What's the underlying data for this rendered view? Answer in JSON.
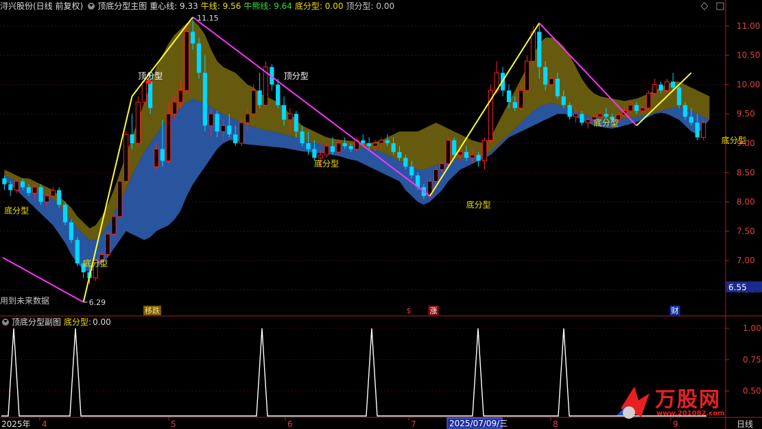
{
  "header": {
    "stock": "浔兴股份(日线 前复权)",
    "indicator": "顶底分型主图",
    "items": [
      {
        "label": "重心线:",
        "value": "9.33",
        "color": "#dcdcdc"
      },
      {
        "label": "牛线:",
        "value": "9.56",
        "color": "#f0e000"
      },
      {
        "label": "牛熊线:",
        "value": "9.64",
        "color": "#33e033"
      },
      {
        "label": "底分型:",
        "value": "0.00",
        "color": "#f0e000"
      },
      {
        "label": "顶分型:",
        "value": "0.00",
        "color": "#c8c8c8"
      }
    ]
  },
  "sub_header": {
    "indicator": "顶底分型副图",
    "label": "底分型:",
    "value": "0.00"
  },
  "future_note": "用到未来数据",
  "period_label": "日线",
  "events": [
    {
      "text": "移跌",
      "bg": "#7a5a10",
      "fg": "#ffe070"
    },
    {
      "text": "$",
      "bg": "#000000",
      "fg": "#ff3030"
    },
    {
      "text": "涨",
      "bg": "#8a1010",
      "fg": "#ffffff"
    },
    {
      "text": "财",
      "bg": "#1030a0",
      "fg": "#ffffff"
    }
  ],
  "date_axis": [
    {
      "text": "2025年",
      "color": "#e0e0e0"
    },
    {
      "text": "4",
      "color": "#e04040"
    },
    {
      "text": "5",
      "color": "#e04040"
    },
    {
      "text": "6",
      "color": "#e04040"
    },
    {
      "text": "7",
      "color": "#e04040"
    },
    {
      "text": "2025/07/09/三",
      "color": "#ffffff",
      "highlight": true
    },
    {
      "text": "8",
      "color": "#e04040"
    },
    {
      "text": "9",
      "color": "#e04040"
    }
  ],
  "watermark": {
    "brand": "万股网",
    "site": "www.201082.com"
  },
  "chart_data": [
    {
      "type": "candlestick",
      "panel": "main",
      "ylim": [
        6.3,
        11.15
      ],
      "yticks": [
        "11.00",
        "10.50",
        "10.00",
        "9.50",
        "9.00",
        "8.50",
        "8.00",
        "7.50",
        "7.00",
        "6.50"
      ],
      "current_price": "6.55",
      "extreme_labels": [
        {
          "text": "11.15",
          "value": 11.15
        },
        {
          "text": "6.29",
          "value": 6.29
        }
      ],
      "candles": [
        [
          8.4,
          8.45,
          8.2,
          8.3
        ],
        [
          8.3,
          8.35,
          8.1,
          8.2
        ],
        [
          8.2,
          8.4,
          8.15,
          8.35
        ],
        [
          8.35,
          8.4,
          8.2,
          8.25
        ],
        [
          8.25,
          8.3,
          8.1,
          8.15
        ],
        [
          8.15,
          8.3,
          8.05,
          8.25
        ],
        [
          8.25,
          8.3,
          7.95,
          8.0
        ],
        [
          8.0,
          8.15,
          7.9,
          8.1
        ],
        [
          8.1,
          8.25,
          8.05,
          8.2
        ],
        [
          8.2,
          8.25,
          7.9,
          7.95
        ],
        [
          7.95,
          8.0,
          7.6,
          7.65
        ],
        [
          7.65,
          7.7,
          7.3,
          7.35
        ],
        [
          7.35,
          7.4,
          6.9,
          6.95
        ],
        [
          6.95,
          7.0,
          6.7,
          6.8
        ],
        [
          6.8,
          6.9,
          6.6,
          6.7
        ],
        [
          6.7,
          7.05,
          6.65,
          7.0
        ],
        [
          7.0,
          7.15,
          6.9,
          7.1
        ],
        [
          7.1,
          7.5,
          7.05,
          7.45
        ],
        [
          7.45,
          7.8,
          7.4,
          7.75
        ],
        [
          7.75,
          8.4,
          7.7,
          8.35
        ],
        [
          8.35,
          9.2,
          8.3,
          9.15
        ],
        [
          9.15,
          9.5,
          8.9,
          9.0
        ],
        [
          9.0,
          9.8,
          8.95,
          9.7
        ],
        [
          9.7,
          10.1,
          9.65,
          10.05
        ],
        [
          10.05,
          10.2,
          9.5,
          9.6
        ],
        [
          8.6,
          9.0,
          8.55,
          8.9
        ],
        [
          8.9,
          9.4,
          8.6,
          8.7
        ],
        [
          8.7,
          9.7,
          8.65,
          9.5
        ],
        [
          9.5,
          9.8,
          9.4,
          9.7
        ],
        [
          9.7,
          10.1,
          9.6,
          9.9
        ],
        [
          9.9,
          11.0,
          9.85,
          10.9
        ],
        [
          10.9,
          11.15,
          10.6,
          10.7
        ],
        [
          10.7,
          10.8,
          10.1,
          10.2
        ],
        [
          10.2,
          10.5,
          9.2,
          9.3
        ],
        [
          9.3,
          9.6,
          9.1,
          9.5
        ],
        [
          9.5,
          9.55,
          9.1,
          9.2
        ],
        [
          9.2,
          9.4,
          9.05,
          9.3
        ],
        [
          9.3,
          9.5,
          9.1,
          9.15
        ],
        [
          9.15,
          9.3,
          8.95,
          9.0
        ],
        [
          9.0,
          9.4,
          8.95,
          9.35
        ],
        [
          9.35,
          9.6,
          9.2,
          9.5
        ],
        [
          9.5,
          10.0,
          9.45,
          9.9
        ],
        [
          9.9,
          10.2,
          9.6,
          9.65
        ],
        [
          9.65,
          10.4,
          9.6,
          10.3
        ],
        [
          10.3,
          10.35,
          9.9,
          10.0
        ],
        [
          10.0,
          10.1,
          9.6,
          9.65
        ],
        [
          9.65,
          9.8,
          9.3,
          9.4
        ],
        [
          9.4,
          9.6,
          9.2,
          9.5
        ],
        [
          9.5,
          9.55,
          9.1,
          9.2
        ],
        [
          9.2,
          9.3,
          8.95,
          9.0
        ],
        [
          9.0,
          9.2,
          8.8,
          8.9
        ],
        [
          8.9,
          9.05,
          8.7,
          8.75
        ],
        [
          8.75,
          8.9,
          8.6,
          8.8
        ],
        [
          8.8,
          9.0,
          8.75,
          8.95
        ],
        [
          8.95,
          9.1,
          8.8,
          8.85
        ],
        [
          8.85,
          9.05,
          8.8,
          9.0
        ],
        [
          9.0,
          9.1,
          8.9,
          8.95
        ],
        [
          8.95,
          9.0,
          8.85,
          8.9
        ],
        [
          8.9,
          9.1,
          8.85,
          9.05
        ],
        [
          9.05,
          9.15,
          8.95,
          9.0
        ],
        [
          9.0,
          9.1,
          8.9,
          8.95
        ],
        [
          8.95,
          9.05,
          8.85,
          9.0
        ],
        [
          9.0,
          9.1,
          8.9,
          9.05
        ],
        [
          9.05,
          9.15,
          8.95,
          9.0
        ],
        [
          9.0,
          9.1,
          8.8,
          8.85
        ],
        [
          8.85,
          8.95,
          8.7,
          8.75
        ],
        [
          8.75,
          8.8,
          8.55,
          8.6
        ],
        [
          8.6,
          8.7,
          8.4,
          8.45
        ],
        [
          8.45,
          8.5,
          8.2,
          8.25
        ],
        [
          8.25,
          8.3,
          8.05,
          8.1
        ],
        [
          8.1,
          8.4,
          8.05,
          8.35
        ],
        [
          8.35,
          8.6,
          8.3,
          8.55
        ],
        [
          8.55,
          8.7,
          8.5,
          8.65
        ],
        [
          8.65,
          9.1,
          8.6,
          9.05
        ],
        [
          9.05,
          9.1,
          8.75,
          8.8
        ],
        [
          8.8,
          8.9,
          8.7,
          8.85
        ],
        [
          8.85,
          8.95,
          8.7,
          8.75
        ],
        [
          8.75,
          8.9,
          8.65,
          8.8
        ],
        [
          8.8,
          8.85,
          8.6,
          8.7
        ],
        [
          8.7,
          9.1,
          8.55,
          9.05
        ],
        [
          9.05,
          10.0,
          9.0,
          9.9
        ],
        [
          9.9,
          10.4,
          9.85,
          10.2
        ],
        [
          10.2,
          10.3,
          9.8,
          9.9
        ],
        [
          9.9,
          10.0,
          9.6,
          9.7
        ],
        [
          9.7,
          9.8,
          9.55,
          9.6
        ],
        [
          9.6,
          10.0,
          9.55,
          9.9
        ],
        [
          9.9,
          10.5,
          9.85,
          10.4
        ],
        [
          10.4,
          11.0,
          10.3,
          10.9
        ],
        [
          10.9,
          11.05,
          10.1,
          10.3
        ],
        [
          10.3,
          10.4,
          9.9,
          10.0
        ],
        [
          10.0,
          10.2,
          9.9,
          10.1
        ],
        [
          10.1,
          10.2,
          9.75,
          9.8
        ],
        [
          9.8,
          9.9,
          9.6,
          9.65
        ],
        [
          9.65,
          9.7,
          9.4,
          9.45
        ],
        [
          9.45,
          9.6,
          9.35,
          9.5
        ],
        [
          9.5,
          9.55,
          9.3,
          9.35
        ],
        [
          9.35,
          9.45,
          9.25,
          9.4
        ],
        [
          9.4,
          9.5,
          9.35,
          9.45
        ],
        [
          9.45,
          9.55,
          9.4,
          9.5
        ],
        [
          9.5,
          9.6,
          9.4,
          9.45
        ],
        [
          9.45,
          9.5,
          9.35,
          9.4
        ],
        [
          9.4,
          9.5,
          9.35,
          9.48
        ],
        [
          9.48,
          9.6,
          9.45,
          9.55
        ],
        [
          9.55,
          9.7,
          9.5,
          9.65
        ],
        [
          9.65,
          9.7,
          9.5,
          9.55
        ],
        [
          9.55,
          9.65,
          9.5,
          9.6
        ],
        [
          9.6,
          9.9,
          9.55,
          9.85
        ],
        [
          9.85,
          10.1,
          9.8,
          10.0
        ],
        [
          10.0,
          10.05,
          9.85,
          9.9
        ],
        [
          9.9,
          10.1,
          9.85,
          10.05
        ],
        [
          10.05,
          10.2,
          9.9,
          9.95
        ],
        [
          9.95,
          10.0,
          9.6,
          9.65
        ],
        [
          9.65,
          9.7,
          9.4,
          9.45
        ],
        [
          9.45,
          9.6,
          9.3,
          9.35
        ],
        [
          9.35,
          9.5,
          9.05,
          9.1
        ],
        [
          9.1,
          9.4,
          9.05,
          9.35
        ]
      ],
      "bands": {
        "upper_outer": [
          8.55,
          8.5,
          8.45,
          8.4,
          8.4,
          8.35,
          8.3,
          8.25,
          8.2,
          8.1,
          8.0,
          7.9,
          7.75,
          7.65,
          7.55,
          7.6,
          7.75,
          7.95,
          8.2,
          8.5,
          8.8,
          9.1,
          9.4,
          9.7,
          10.0,
          10.3,
          10.5,
          10.7,
          10.85,
          10.95,
          11.05,
          11.1,
          11.0,
          10.85,
          10.6,
          10.4,
          10.3,
          10.25,
          10.2,
          10.1,
          10.0,
          9.95,
          9.85,
          9.8,
          9.75,
          9.7,
          9.6,
          9.5,
          9.4,
          9.3,
          9.25,
          9.2,
          9.15,
          9.1,
          9.08,
          9.06,
          9.05,
          9.04,
          9.02,
          9.0,
          9.0,
          9.02,
          9.05,
          9.1,
          9.15,
          9.2,
          9.2,
          9.2,
          9.2,
          9.25,
          9.3,
          9.35,
          9.3,
          9.25,
          9.2,
          9.15,
          9.1,
          9.05,
          9.02,
          9.0,
          9.1,
          9.3,
          9.5,
          9.7,
          9.9,
          10.1,
          10.3,
          10.5,
          10.7,
          10.8,
          10.8,
          10.75,
          10.65,
          10.5,
          10.3,
          10.1,
          9.95,
          9.85,
          9.8,
          9.78,
          9.76,
          9.74,
          9.72,
          9.74,
          9.76,
          9.8,
          9.85,
          9.9,
          9.95,
          10.0,
          10.05,
          10.05,
          10.0,
          9.95,
          9.9,
          9.85,
          9.8
        ],
        "middle": [
          8.45,
          8.4,
          8.35,
          8.3,
          8.25,
          8.2,
          8.15,
          8.1,
          8.05,
          7.95,
          7.8,
          7.7,
          7.55,
          7.45,
          7.35,
          7.35,
          7.45,
          7.6,
          7.8,
          8.0,
          8.2,
          8.45,
          8.65,
          8.85,
          9.0,
          9.15,
          9.3,
          9.4,
          9.5,
          9.6,
          9.7,
          9.75,
          9.72,
          9.68,
          9.62,
          9.55,
          9.5,
          9.45,
          9.4,
          9.35,
          9.3,
          9.28,
          9.25,
          9.22,
          9.2,
          9.18,
          9.15,
          9.12,
          9.1,
          9.06,
          9.02,
          9.0,
          8.98,
          8.96,
          8.95,
          8.95,
          8.95,
          8.94,
          8.93,
          8.92,
          8.9,
          8.88,
          8.85,
          8.8,
          8.75,
          8.7,
          8.65,
          8.6,
          8.55,
          8.55,
          8.58,
          8.62,
          8.66,
          8.7,
          8.72,
          8.74,
          8.75,
          8.76,
          8.77,
          8.78,
          8.85,
          8.95,
          9.05,
          9.15,
          9.25,
          9.35,
          9.45,
          9.55,
          9.62,
          9.66,
          9.68,
          9.66,
          9.62,
          9.58,
          9.54,
          9.5,
          9.46,
          9.44,
          9.42,
          9.4,
          9.4,
          9.41,
          9.42,
          9.43,
          9.45,
          9.47,
          9.5,
          9.52,
          9.55,
          9.58,
          9.6,
          9.62,
          9.6,
          9.55,
          9.5,
          9.45,
          9.4
        ],
        "lower_outer": [
          8.35,
          8.3,
          8.2,
          8.1,
          8.0,
          7.9,
          7.8,
          7.7,
          7.6,
          7.45,
          7.3,
          7.1,
          6.95,
          6.85,
          6.8,
          6.85,
          6.95,
          7.05,
          7.2,
          7.35,
          7.5,
          7.45,
          7.4,
          7.35,
          7.4,
          7.5,
          7.55,
          7.6,
          7.7,
          7.85,
          8.1,
          8.3,
          8.45,
          8.6,
          8.75,
          8.9,
          9.0,
          9.05,
          9.05,
          9.0,
          8.98,
          8.97,
          8.96,
          8.95,
          8.94,
          8.93,
          8.92,
          8.9,
          8.88,
          8.86,
          8.85,
          8.84,
          8.83,
          8.82,
          8.8,
          8.78,
          8.75,
          8.72,
          8.7,
          8.65,
          8.6,
          8.55,
          8.5,
          8.45,
          8.4,
          8.35,
          8.2,
          8.1,
          8.0,
          7.95,
          8.0,
          8.1,
          8.2,
          8.35,
          8.45,
          8.55,
          8.6,
          8.65,
          8.7,
          8.75,
          8.8,
          8.9,
          9.0,
          9.1,
          9.15,
          9.2,
          9.25,
          9.3,
          9.35,
          9.4,
          9.45,
          9.5,
          9.5,
          9.48,
          9.45,
          9.4,
          9.35,
          9.3,
          9.28,
          9.26,
          9.25,
          9.27,
          9.3,
          9.33,
          9.36,
          9.4,
          9.45,
          9.5,
          9.52,
          9.5,
          9.45,
          9.4,
          9.3,
          9.2,
          9.15
        ]
      },
      "zigzag_up": [
        [
          13,
          6.29
        ],
        [
          21,
          9.8
        ],
        [
          31,
          11.15
        ],
        [
          70,
          8.1
        ],
        [
          88,
          11.05
        ],
        [
          104,
          9.3
        ],
        [
          113,
          10.2
        ]
      ],
      "zigzag_labels": [
        {
          "text": "底分型",
          "index": 2,
          "value": 7.8,
          "color": "#f0e000"
        },
        {
          "text": "底分型",
          "index": 15,
          "value": 6.9,
          "color": "#f0e000"
        },
        {
          "text": "顶分型",
          "index": 24,
          "value": 10.1,
          "color": "#ffffff"
        },
        {
          "text": "顶分型",
          "index": 48,
          "value": 10.1,
          "color": "#ffffff"
        },
        {
          "text": "底分型",
          "index": 53,
          "value": 8.6,
          "color": "#f0e000"
        },
        {
          "text": "底分型",
          "index": 78,
          "value": 7.9,
          "color": "#f0e000"
        },
        {
          "text": "底分型",
          "index": 99,
          "value": 9.3,
          "color": "#f0e000"
        },
        {
          "text": "底分型",
          "index": 120,
          "value": 9.0,
          "color": "#f0e000"
        }
      ]
    },
    {
      "type": "line",
      "panel": "sub",
      "ylim": [
        0.3,
        1.05
      ],
      "yticks": [
        "1.00",
        "0.75",
        "0.50"
      ],
      "series": [
        {
          "name": "底分型",
          "spike_indices": [
            3,
            16,
            54,
            78,
            100,
            118
          ]
        }
      ]
    }
  ]
}
